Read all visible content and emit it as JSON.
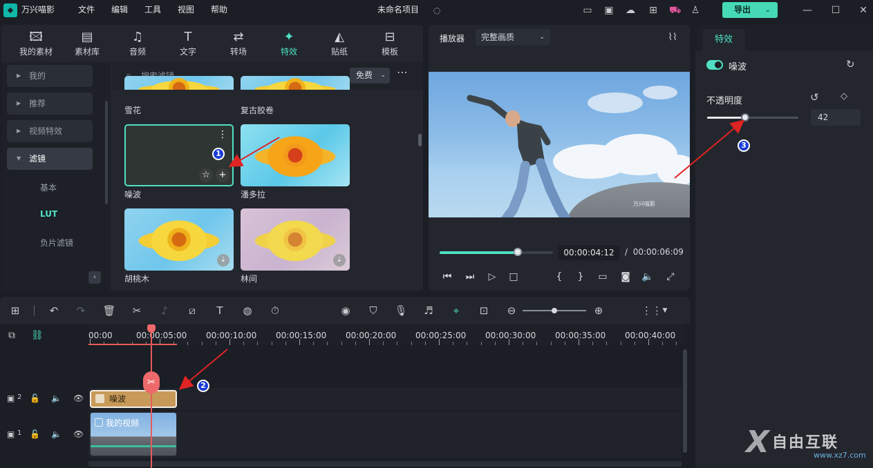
{
  "titlebar": {
    "app_name": "万兴喵影",
    "menus": [
      "文件",
      "编辑",
      "工具",
      "视图",
      "帮助"
    ],
    "project_name": "未命名项目",
    "export_label": "导出"
  },
  "library": {
    "tabs": [
      {
        "label": "我的素材",
        "icon": "image-icon"
      },
      {
        "label": "素材库",
        "icon": "library-icon"
      },
      {
        "label": "音频",
        "icon": "music-note-icon"
      },
      {
        "label": "文字",
        "icon": "text-icon"
      },
      {
        "label": "转场",
        "icon": "transition-icon"
      },
      {
        "label": "特效",
        "icon": "effects-icon"
      },
      {
        "label": "贴纸",
        "icon": "sticker-icon"
      },
      {
        "label": "模板",
        "icon": "template-icon"
      }
    ],
    "nav": [
      "我的",
      "推荐",
      "视频特效",
      "滤镜"
    ],
    "sub_nav": [
      "基本",
      "LUT",
      "负片滤镜"
    ],
    "search_placeholder": "搜索滤镜",
    "price_filter": "免费",
    "items": [
      {
        "name": "雪花"
      },
      {
        "name": "复古胶卷"
      },
      {
        "name": "噪波"
      },
      {
        "name": "潘多拉"
      },
      {
        "name": "胡桃木"
      },
      {
        "name": "林间"
      }
    ]
  },
  "player": {
    "label": "播放器",
    "quality": "完整画质",
    "progress": 0.688,
    "current_time": "00:00:04:12",
    "separator": "/",
    "total_time": "00:00:06:09",
    "watermark": "万兴喵影"
  },
  "properties": {
    "tab": "特效",
    "effect_name": "噪波",
    "enabled": true,
    "opacity_label": "不透明度",
    "opacity_value": "42",
    "opacity_fraction": 0.42
  },
  "timeline": {
    "ruler_labels": [
      "00:00",
      "00:00:05:00",
      "00:00:10:00",
      "00:00:15:00",
      "00:00:20:00",
      "00:00:25:00",
      "00:00:30:00",
      "00:00:35:00",
      "00:00:40:00"
    ],
    "tracks": [
      {
        "number": "2",
        "clip_label": "噪波"
      },
      {
        "number": "1",
        "clip_label": "我的视频"
      }
    ]
  },
  "annotations": [
    "1",
    "2",
    "3"
  ],
  "watermark": {
    "brand": "自由互联",
    "url": "www.xz7.com"
  },
  "colors": {
    "accent": "#4fe0c4",
    "playhead": "#e55b5b",
    "badge": "#1a3bd6",
    "arrow": "#e02424"
  }
}
